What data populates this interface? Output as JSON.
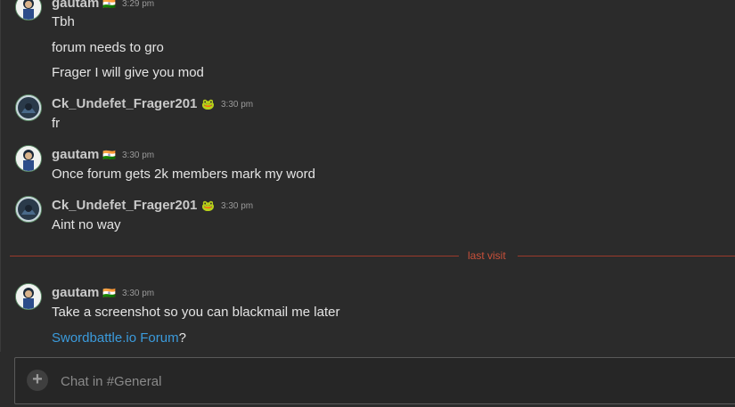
{
  "messages": [
    {
      "author": "gautam",
      "badge": "🇮🇳",
      "time": "3:29 pm",
      "lines": [
        "Tbh",
        "forum needs to gro",
        "Frager I will give you mod"
      ]
    },
    {
      "author": "Ck_Undefet_Frager201",
      "badge": "🐸",
      "time": "3:30 pm",
      "lines": [
        "fr"
      ]
    },
    {
      "author": "gautam",
      "badge": "🇮🇳",
      "time": "3:30 pm",
      "lines": [
        "Once forum gets 2k members mark my word"
      ]
    },
    {
      "author": "Ck_Undefet_Frager201",
      "badge": "🐸",
      "time": "3:30 pm",
      "lines": [
        "Aint no way"
      ]
    },
    {
      "author": "gautam",
      "badge": "🇮🇳",
      "time": "3:30 pm",
      "lines": [
        "Take a screenshot so you can blackmail me later"
      ],
      "link_text": "Swordbattle.io Forum",
      "link_suffix": "?"
    }
  ],
  "divider_label": "last visit",
  "composer": {
    "placeholder": "Chat in #General",
    "add_icon": "plus-icon"
  },
  "colors": {
    "background": "#2b2b2b",
    "divider": "#c9503a",
    "link": "#3b9bdc"
  }
}
